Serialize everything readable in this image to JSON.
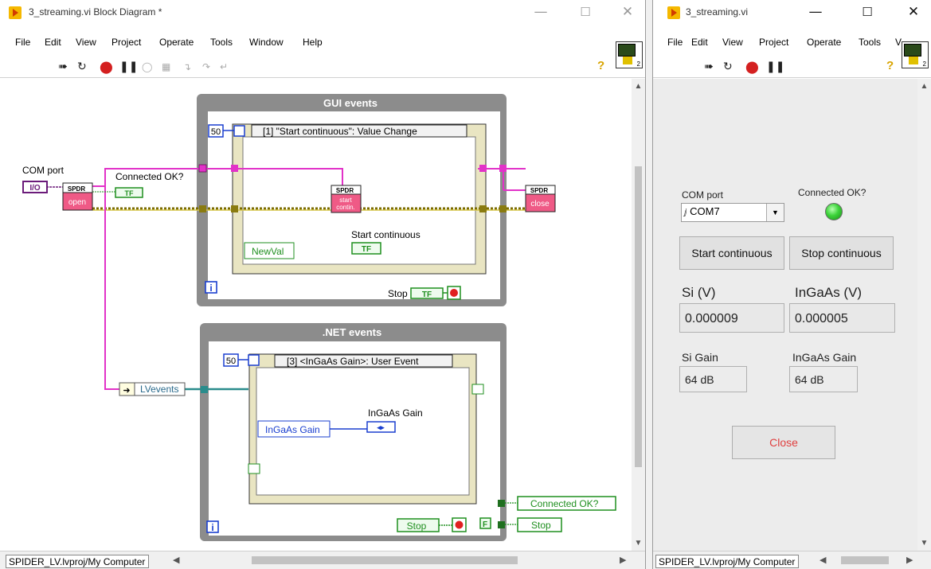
{
  "block_diagram": {
    "title": "3_streaming.vi Block Diagram *",
    "menu": [
      "File",
      "Edit",
      "View",
      "Project",
      "Operate",
      "Tools",
      "Window",
      "Help"
    ],
    "loop1": {
      "title": "GUI events",
      "timeout": "50",
      "event_case": "[1] \"Start continuous\": Value Change",
      "newval": "NewVal",
      "start_label": "Start continuous",
      "stop_label": "Stop",
      "iter": "i"
    },
    "loop2": {
      "title": ".NET events",
      "timeout": "50",
      "event_case": "[3] <InGaAs Gain>: User Event",
      "gain_node": "InGaAs Gain",
      "gain_label": "InGaAs Gain",
      "stop_local": "Stop",
      "iter": "i"
    },
    "com_port_label": "COM port",
    "io_const": "I/O",
    "connected_label": "Connected OK?",
    "tf": "TF",
    "lvevents": "LVevents",
    "spdr": "SPDR",
    "open": "open",
    "start_contin_1": "start",
    "start_contin_2": "contin.",
    "close": "close",
    "false_const": "F",
    "local_connected": "Connected OK?",
    "local_stop": "Stop",
    "status": "SPIDER_LV.lvproj/My Computer"
  },
  "front_panel": {
    "title": "3_streaming.vi",
    "menu": [
      "File",
      "Edit",
      "View",
      "Project",
      "Operate",
      "Tools",
      "V"
    ],
    "com_port_label": "COM port",
    "com_port_value": "COM7",
    "connected_label": "Connected OK?",
    "start_btn": "Start continuous",
    "stop_btn": "Stop continuous",
    "si_label": "Si (V)",
    "si_value": "0.000009",
    "ingaas_label": "InGaAs (V)",
    "ingaas_value": "0.000005",
    "si_gain_label": "Si Gain",
    "si_gain_value": "64 dB",
    "ingaas_gain_label": "InGaAs Gain",
    "ingaas_gain_value": "64 dB",
    "close_btn": "Close",
    "status": "SPIDER_LV.lvproj/My Computer"
  }
}
